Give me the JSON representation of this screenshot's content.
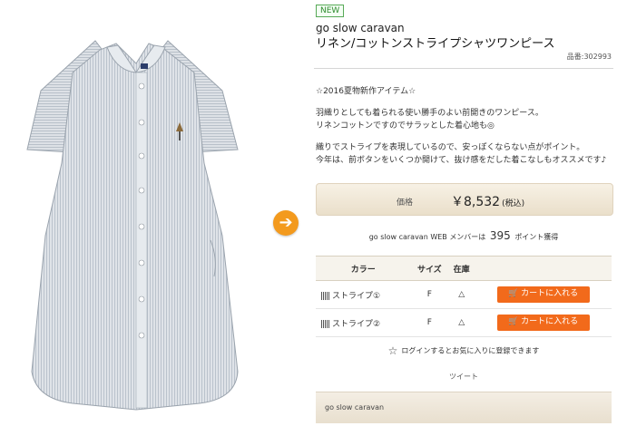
{
  "product": {
    "badge": "NEW",
    "brand": "go slow caravan",
    "name": "リネン/コットンストライプシャツワンピース",
    "code": "品番:302993"
  },
  "description": {
    "line1": "☆2016夏物新作アイテム☆",
    "line2": "羽織りとしても着られる使い勝手のよい前開きのワンピース。",
    "line3": "リネンコットンですのでサラッとした着心地も◎",
    "line4": "織りでストライプを表現しているので、安っぽくならない点がポイント。",
    "line5": "今年は、前ボタンをいくつか開けて、抜け感をだした着こなしもオススメです♪"
  },
  "price": {
    "label": "価格",
    "value": "￥8,532",
    "tax": "(税込)"
  },
  "points": {
    "prefix": "go slow caravan WEB メンバーは",
    "amount": "395",
    "suffix": "ポイント獲得"
  },
  "stock_table": {
    "headers": [
      "カラー",
      "サイズ",
      "在庫",
      ""
    ],
    "rows": [
      {
        "color": "ストライプ①",
        "size": "F",
        "stock": "△",
        "button": "カートに入れる"
      },
      {
        "color": "ストライプ②",
        "size": "F",
        "stock": "△",
        "button": "カートに入れる"
      }
    ]
  },
  "favorite": "ログインするとお気に入りに登録できます",
  "tweet": "ツイート",
  "brand_footer": "go slow caravan",
  "colors": {
    "accent": "#f39a1e",
    "cart_button": "#f26a1b",
    "new_badge": "#57a957"
  }
}
